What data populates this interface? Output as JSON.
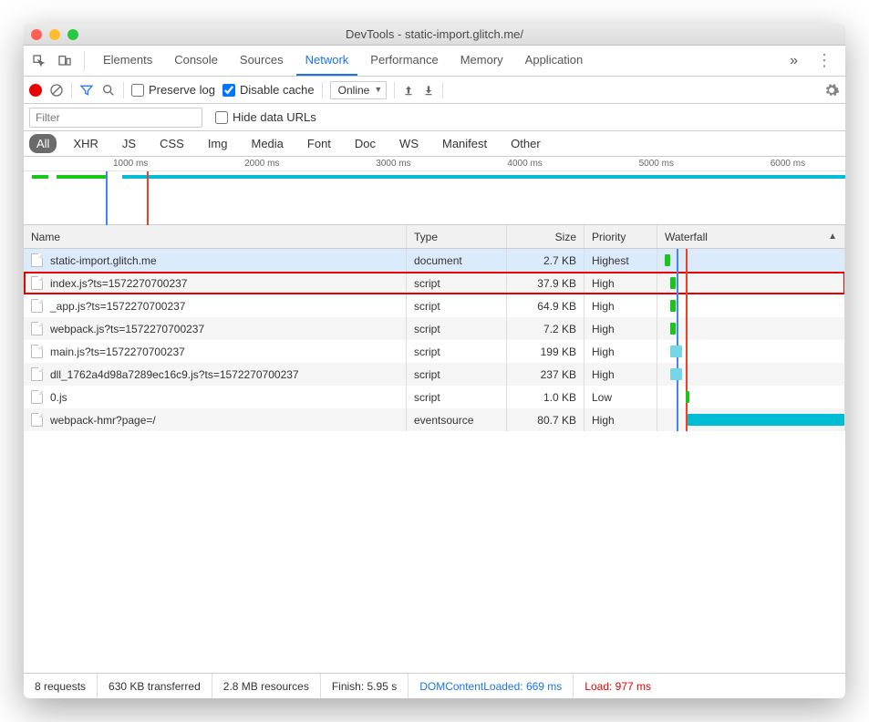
{
  "window_title": "DevTools - static-import.glitch.me/",
  "main_tabs": [
    "Elements",
    "Console",
    "Sources",
    "Network",
    "Performance",
    "Memory",
    "Application"
  ],
  "active_main_tab": "Network",
  "toolbar": {
    "preserve_label": "Preserve log",
    "disable_cache_label": "Disable cache",
    "throttle_value": "Online"
  },
  "filter_placeholder": "Filter",
  "hide_urls_label": "Hide data URLs",
  "type_filters": [
    "All",
    "XHR",
    "JS",
    "CSS",
    "Img",
    "Media",
    "Font",
    "Doc",
    "WS",
    "Manifest",
    "Other"
  ],
  "active_type_filter": "All",
  "overview_ticks": [
    {
      "label": "1000 ms",
      "pct": 13
    },
    {
      "label": "2000 ms",
      "pct": 29
    },
    {
      "label": "3000 ms",
      "pct": 45
    },
    {
      "label": "4000 ms",
      "pct": 61
    },
    {
      "label": "5000 ms",
      "pct": 77
    },
    {
      "label": "6000 ms",
      "pct": 93
    }
  ],
  "columns": {
    "name": "Name",
    "type": "Type",
    "size": "Size",
    "priority": "Priority",
    "waterfall": "Waterfall"
  },
  "rows": [
    {
      "name": "static-import.glitch.me",
      "type": "document",
      "size": "2.7 KB",
      "priority": "Highest",
      "selected": true,
      "wf": {
        "start": 4,
        "width": 3,
        "color": "#19c719"
      }
    },
    {
      "name": "index.js?ts=1572270700237",
      "type": "script",
      "size": "37.9 KB",
      "priority": "High",
      "highlight": true,
      "wf": {
        "start": 7,
        "width": 3,
        "color": "#19c719"
      }
    },
    {
      "name": "_app.js?ts=1572270700237",
      "type": "script",
      "size": "64.9 KB",
      "priority": "High",
      "wf": {
        "start": 7,
        "width": 3,
        "color": "#19c719"
      }
    },
    {
      "name": "webpack.js?ts=1572270700237",
      "type": "script",
      "size": "7.2 KB",
      "priority": "High",
      "wf": {
        "start": 7,
        "width": 3,
        "color": "#19c719"
      }
    },
    {
      "name": "main.js?ts=1572270700237",
      "type": "script",
      "size": "199 KB",
      "priority": "High",
      "wf": {
        "start": 7,
        "width": 6,
        "color": "#75d6e6"
      }
    },
    {
      "name": "dll_1762a4d98a7289ec16c9.js?ts=1572270700237",
      "type": "script",
      "size": "237 KB",
      "priority": "High",
      "wf": {
        "start": 7,
        "width": 6,
        "color": "#75d6e6"
      }
    },
    {
      "name": "0.js",
      "type": "script",
      "size": "1.0 KB",
      "priority": "Low",
      "wf": {
        "start": 15,
        "width": 2,
        "color": "#19c719"
      }
    },
    {
      "name": "webpack-hmr?page=/",
      "type": "eventsource",
      "size": "80.7 KB",
      "priority": "High",
      "wf": {
        "start": 16,
        "width": 84,
        "color": "#00bcd4"
      }
    }
  ],
  "waterfall_markers": {
    "blue": 10,
    "red": 15
  },
  "status": {
    "requests": "8 requests",
    "transferred": "630 KB transferred",
    "resources": "2.8 MB resources",
    "finish": "Finish: 5.95 s",
    "dcl": "DOMContentLoaded: 669 ms",
    "load": "Load: 977 ms"
  }
}
